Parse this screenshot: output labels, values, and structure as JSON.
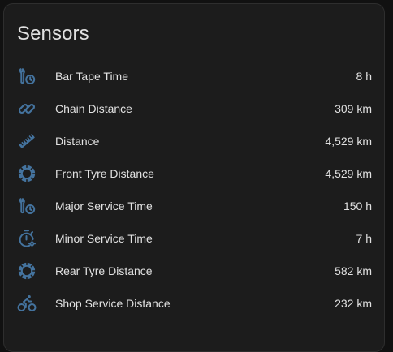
{
  "colors": {
    "icon": "#44739e",
    "text": "#e1e1e1",
    "card_background": "#1c1c1c",
    "page_background": "#111111"
  },
  "card": {
    "title": "Sensors"
  },
  "sensors": [
    {
      "icon": "wrench-clock-icon",
      "label": "Bar Tape Time",
      "value": "8 h"
    },
    {
      "icon": "link-icon",
      "label": "Chain Distance",
      "value": "309 km"
    },
    {
      "icon": "ruler-icon",
      "label": "Distance",
      "value": "4,529 km"
    },
    {
      "icon": "tire-icon",
      "label": "Front Tyre Distance",
      "value": "4,529 km"
    },
    {
      "icon": "wrench-clock-icon",
      "label": "Major Service Time",
      "value": "150 h"
    },
    {
      "icon": "timer-cog-icon",
      "label": "Minor Service Time",
      "value": "7 h"
    },
    {
      "icon": "tire-icon",
      "label": "Rear Tyre Distance",
      "value": "582 km"
    },
    {
      "icon": "bike-icon",
      "label": "Shop Service Distance",
      "value": "232 km"
    }
  ]
}
